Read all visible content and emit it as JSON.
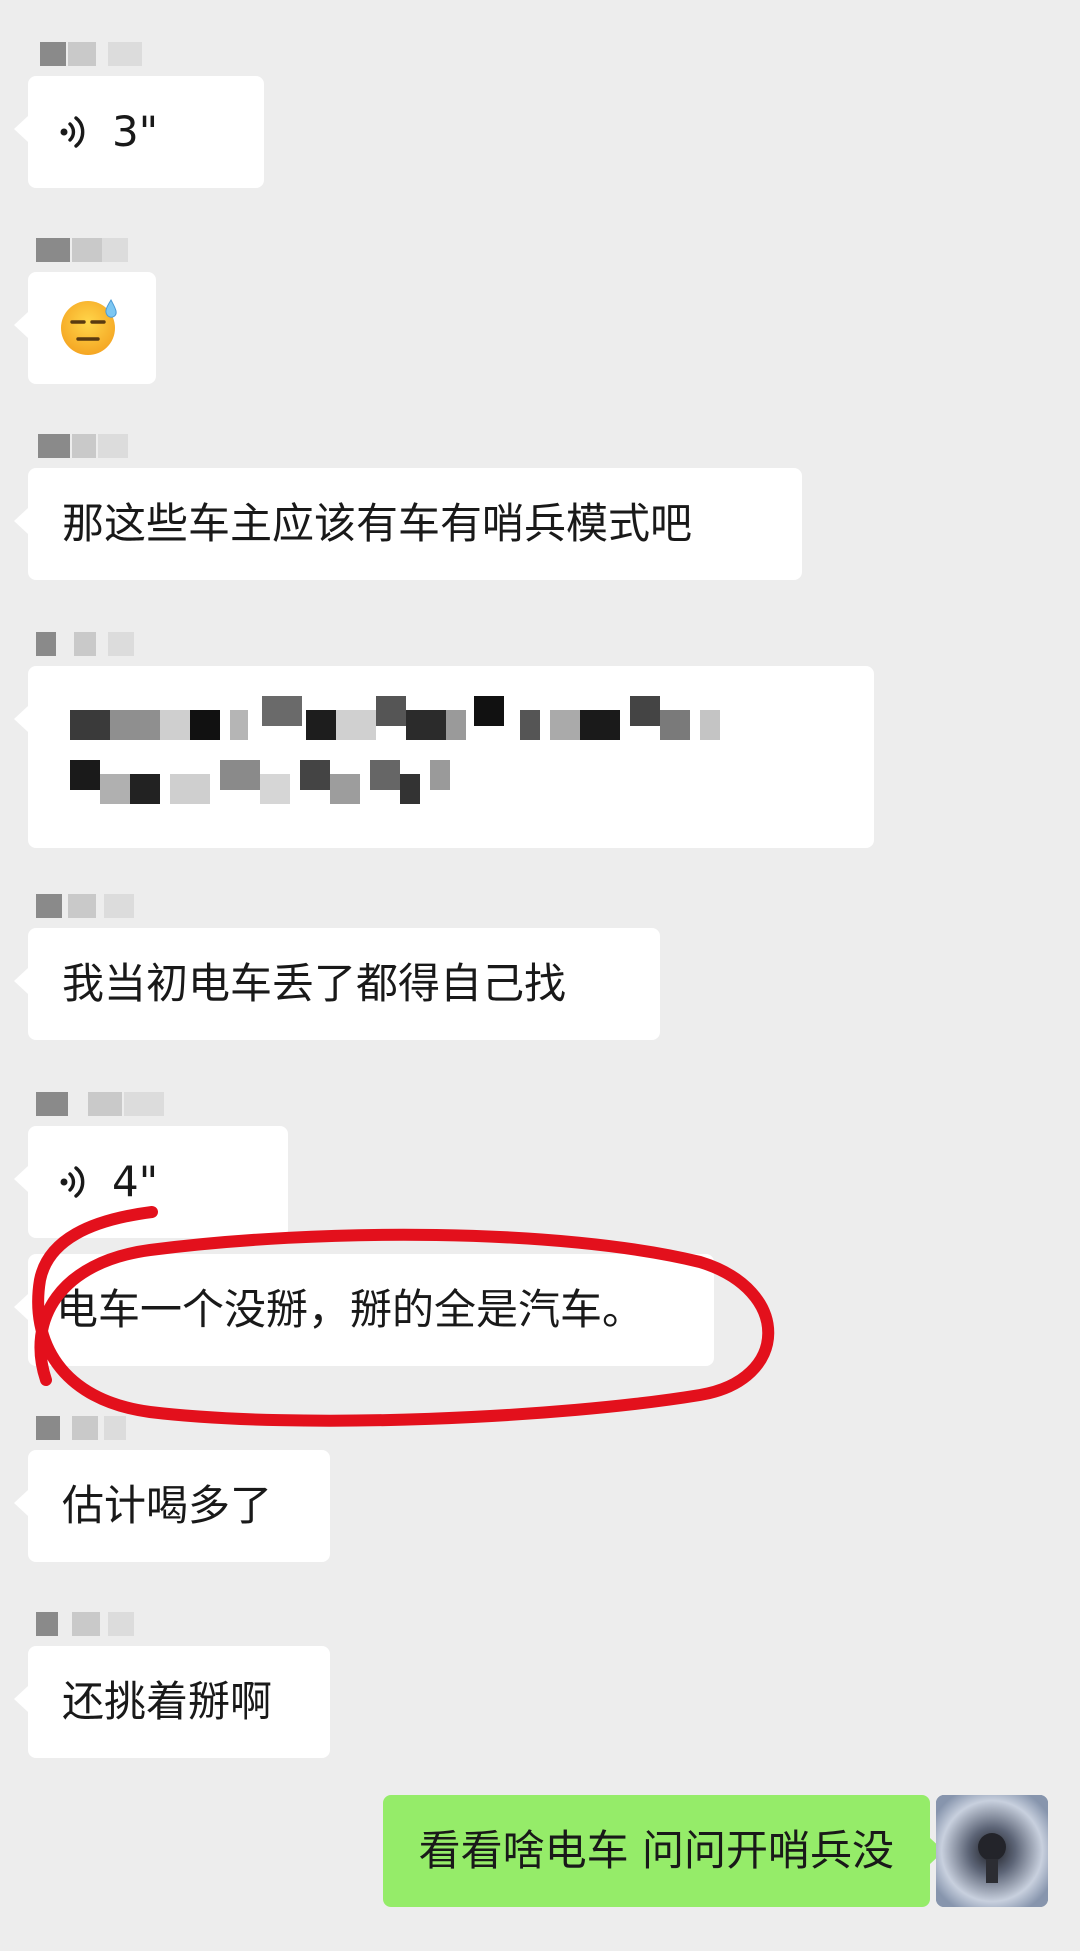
{
  "messages": {
    "m1": {
      "duration": "3\""
    },
    "m3": {
      "text": "那这些车主应该有车有哨兵模式吧"
    },
    "m5": {
      "text": "我当初电车丢了都得自己找"
    },
    "m6": {
      "duration": "4\""
    },
    "m7": {
      "text": "电车一个没掰，掰的全是汽车。"
    },
    "m8": {
      "text": "估计喝多了"
    },
    "m9": {
      "text": "还挑着掰啊"
    }
  },
  "self_message": {
    "text": "看看啥电车  问问开哨兵没"
  },
  "colors": {
    "background": "#ededed",
    "incoming_bubble": "#ffffff",
    "outgoing_bubble": "#95ec69",
    "annotation": "#e3101c"
  },
  "icons": [
    "voice-icon",
    "sweat-emoji-icon"
  ]
}
